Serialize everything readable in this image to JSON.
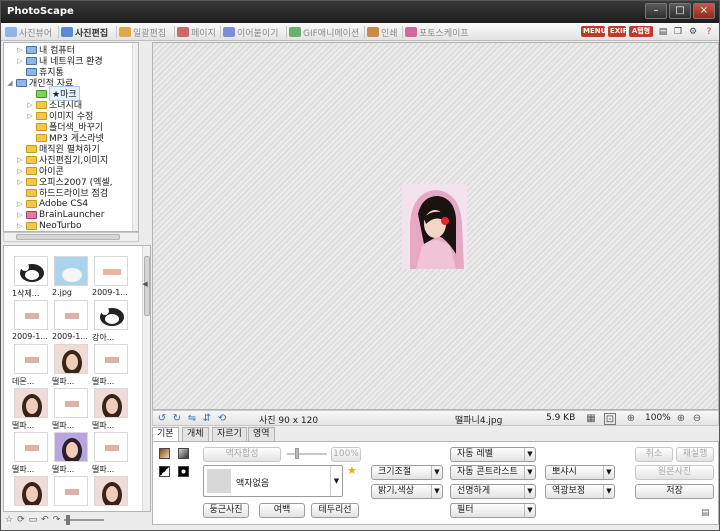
{
  "window": {
    "title": "PhotoScape",
    "controls": [
      "–",
      "□",
      "×"
    ]
  },
  "tabs": [
    {
      "label": "사진뷰어",
      "icon": "viewer-icon",
      "color": "#8fb6e6",
      "active": false
    },
    {
      "label": "사진편집",
      "icon": "editor-icon",
      "color": "#5a8ad6",
      "active": true
    },
    {
      "label": "일괄편집",
      "icon": "batch-icon",
      "color": "#e0a84a",
      "active": false
    },
    {
      "label": "페이지",
      "icon": "page-icon",
      "color": "#c86a6a",
      "active": false
    },
    {
      "label": "이어붙이기",
      "icon": "combine-icon",
      "color": "#7c8fd6",
      "active": false
    },
    {
      "label": "GIF애니메이션",
      "icon": "gif-icon",
      "color": "#6bb06b",
      "active": false
    },
    {
      "label": "인쇄",
      "icon": "print-icon",
      "color": "#c98a4a",
      "active": false
    },
    {
      "label": "포토스케이프",
      "icon": "photoscape-icon",
      "color": "#d06a9a",
      "active": false
    }
  ],
  "top_right": {
    "menu_badge": "MENU",
    "exif_badge": "EXIF",
    "third_badge": "A탭형"
  },
  "tree": [
    {
      "label": "내 컴퓨터",
      "indent": 1,
      "arrow": "▷",
      "icon": "computer"
    },
    {
      "label": "내 네트워크 환경",
      "indent": 1,
      "arrow": "▷",
      "icon": "network"
    },
    {
      "label": "휴지통",
      "indent": 1,
      "arrow": "",
      "icon": "trash"
    },
    {
      "label": "개인적 자료",
      "indent": 0,
      "arrow": "◢",
      "icon": "user"
    },
    {
      "label": "★마크",
      "indent": 2,
      "arrow": "",
      "icon": "green",
      "selected": true
    },
    {
      "label": "소녀시대",
      "indent": 2,
      "arrow": "▷",
      "icon": "yellow"
    },
    {
      "label": "이미지 수정",
      "indent": 2,
      "arrow": "▷",
      "icon": "yellow"
    },
    {
      "label": "폴더색_바꾸기",
      "indent": 2,
      "arrow": "",
      "icon": "yellow"
    },
    {
      "label": "MP3 게스라넷",
      "indent": 2,
      "arrow": "",
      "icon": "yellow"
    },
    {
      "label": "매직윈 펼쳐하기",
      "indent": 1,
      "arrow": "",
      "icon": "yellow"
    },
    {
      "label": "사진편집기,이미지",
      "indent": 1,
      "arrow": "▷",
      "icon": "yellow"
    },
    {
      "label": "아이콘",
      "indent": 1,
      "arrow": "▷",
      "icon": "yellow"
    },
    {
      "label": "오피스2007 (엑셀,",
      "indent": 1,
      "arrow": "▷",
      "icon": "yellow"
    },
    {
      "label": "하드드라이브 점검",
      "indent": 1,
      "arrow": "",
      "icon": "yellow"
    },
    {
      "label": "Adobe CS4",
      "indent": 1,
      "arrow": "▷",
      "icon": "yellow"
    },
    {
      "label": "BrainLauncher",
      "indent": 1,
      "arrow": "▷",
      "icon": "red"
    },
    {
      "label": "NeoTurbo",
      "indent": 1,
      "arrow": "▷",
      "icon": "yellow"
    }
  ],
  "thumbnails": [
    {
      "caption": "1삭제...",
      "kind": "cow"
    },
    {
      "caption": "2.jpg",
      "kind": "sky"
    },
    {
      "caption": "2009-1...",
      "kind": "text"
    },
    {
      "caption": "2009-1...",
      "kind": "tiny"
    },
    {
      "caption": "2009-1...",
      "kind": "tiny"
    },
    {
      "caption": "강아...",
      "kind": "cow"
    },
    {
      "caption": "데몬...",
      "kind": "tiny"
    },
    {
      "caption": "떨파...",
      "kind": "face"
    },
    {
      "caption": "떨파...",
      "kind": "tiny"
    },
    {
      "caption": "떨파...",
      "kind": "face"
    },
    {
      "caption": "떨파...",
      "kind": "tiny"
    },
    {
      "caption": "떨파...",
      "kind": "face"
    },
    {
      "caption": "떨파...",
      "kind": "tiny"
    },
    {
      "caption": "떨파...",
      "kind": "facepurple"
    },
    {
      "caption": "떨파...",
      "kind": "tiny"
    },
    {
      "caption": "",
      "kind": "face"
    },
    {
      "caption": "",
      "kind": "tiny"
    },
    {
      "caption": "",
      "kind": "face"
    }
  ],
  "status": {
    "size_text": "사진 90 x 120",
    "filename": "떨파니4.jpg",
    "filesize": "5.9 KB",
    "zoom": "100%"
  },
  "edit_tabs": [
    "기본",
    "개체",
    "자르기",
    "영역"
  ],
  "edit": {
    "frame_combine": "액자합성",
    "opacity": "100%",
    "frame_select": "액자없음",
    "round_photo": "둥근사진",
    "margin": "여백",
    "border": "테두리선",
    "resize": "크기조절",
    "brightness_color": "밝기,색상",
    "auto_level": "자동 레벨",
    "auto_contrast": "자동 콘트라스트",
    "sharpen": "선명하게",
    "filter": "필터",
    "backlight": "뽀샤시",
    "backlight_correct": "역광보정",
    "undo": "취소",
    "redo": "재실행",
    "original": "원본사진",
    "save": "저장"
  }
}
